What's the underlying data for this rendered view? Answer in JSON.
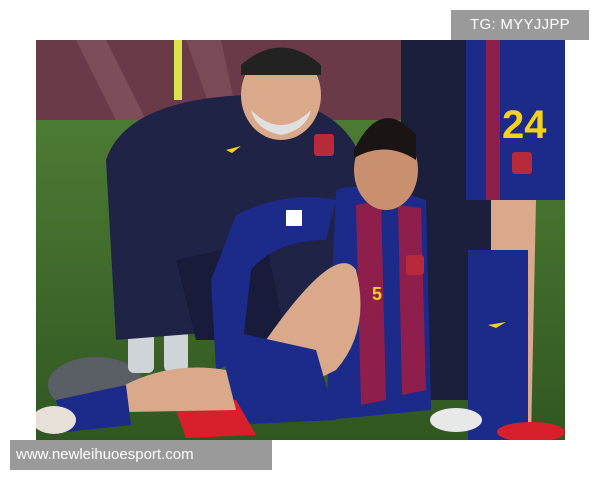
{
  "watermarks": {
    "top_right": "TG: MYYJJPP",
    "bottom_left": "www.newleihuoesport.com"
  },
  "photo": {
    "jersey_number": "24",
    "shirt_sponsor_number": "5"
  },
  "colors": {
    "pitch": "#3f6b2c",
    "stand": "#6a3a48",
    "kit_blue": "#1c2a8a",
    "kit_red": "#8e1f4c",
    "number_yellow": "#f4d11a",
    "staff_jacket": "#1f2346",
    "boot_red": "#d8202c",
    "watermark_bg": "#9a9a9a"
  }
}
